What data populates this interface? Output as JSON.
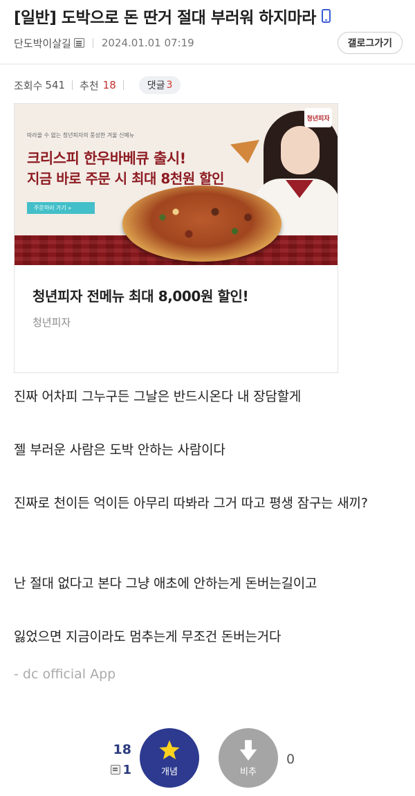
{
  "post": {
    "title": "[일반] 도박으로 돈 딴거 절대 부러워 하지마라",
    "author": "단도박이살길",
    "date": "2024.01.01 07:19",
    "gallery_button": "갤로그가기",
    "views_label": "조회수",
    "views": "541",
    "recommend_label": "추천",
    "recommend": "18",
    "comments_label": "댓글",
    "comments": "3"
  },
  "ad": {
    "brand_badge": "청년피자",
    "banner_small": "따라올 수 없는 청년피자의 풍성한 겨울 신메뉴",
    "banner_line1": "크리스피 한우바베큐 출시!",
    "banner_line2": "지금 바로 주문 시 최대 8천원 할인",
    "banner_cta": "주문하러 가기 »",
    "title": "청년피자 전메뉴 최대 8,000원 할인!",
    "sponsor": "청년피자"
  },
  "body": {
    "p1": "진짜 어차피 그누구든 그날은 반드시온다 내 장담할게",
    "p2": "젤 부러운 사람은 도박 안하는 사람이다",
    "p3": "진짜로 천이든 억이든 아무리 따봐라 그거 따고 평생 잠구는 새끼?",
    "p4": "난 절대 없다고 본다 그냥 애초에 안하는게 돈버는길이고",
    "p5": "잃었으면 지금이라도 멈추는게 무조건 돈버는거다",
    "signature": "- dc official App"
  },
  "vote": {
    "recommend_count": "18",
    "fixed_recommend_count": "1",
    "up_label": "개념",
    "down_label": "비추",
    "down_count": "0"
  }
}
